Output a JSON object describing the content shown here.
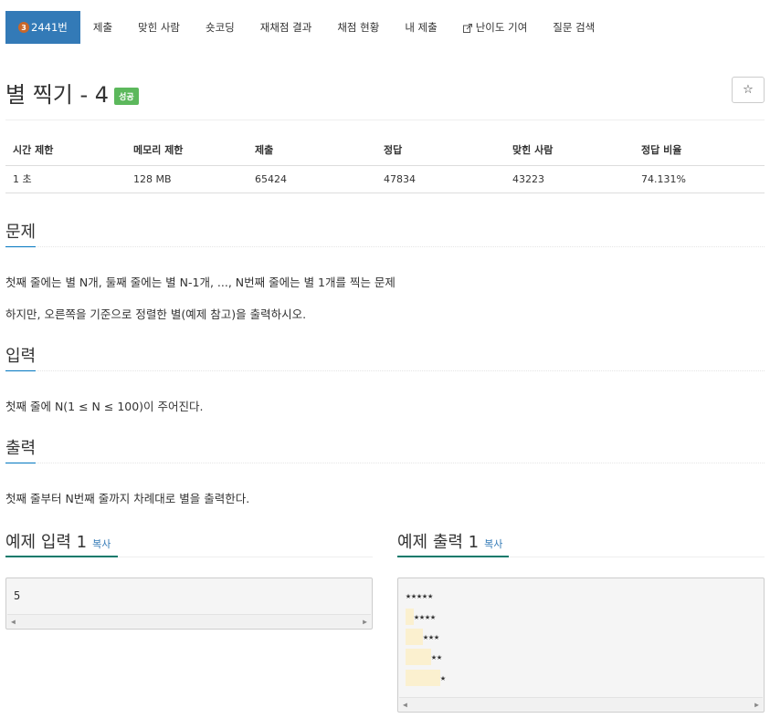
{
  "tabs": [
    {
      "label": "2441번",
      "tier": "3",
      "active": true
    },
    {
      "label": "제출"
    },
    {
      "label": "맞힌 사람"
    },
    {
      "label": "숏코딩"
    },
    {
      "label": "재채점 결과"
    },
    {
      "label": "채점 현황"
    },
    {
      "label": "내 제출"
    },
    {
      "label": "난이도 기여"
    },
    {
      "label": "질문 검색"
    }
  ],
  "problem": {
    "title": "별 찍기 - 4",
    "status_badge": "성공",
    "star_icon": "☆"
  },
  "info_table": {
    "headers": [
      "시간 제한",
      "메모리 제한",
      "제출",
      "정답",
      "맞힌 사람",
      "정답 비율"
    ],
    "values": [
      "1 초",
      "128 MB",
      "65424",
      "47834",
      "43223",
      "74.131%"
    ]
  },
  "sections": {
    "description_heading": "문제",
    "description_lines": [
      "첫째 줄에는 별 N개, 둘째 줄에는 별 N-1개, ..., N번째 줄에는 별 1개를 찍는 문제",
      "하지만, 오른쪽을 기준으로 정렬한 별(예제 참고)을 출력하시오."
    ],
    "input_heading": "입력",
    "input_text": "첫째 줄에 N(1 ≤ N ≤ 100)이 주어진다.",
    "output_heading": "출력",
    "output_text": "첫째 줄부터 N번째 줄까지 차례대로 별을 출력한다."
  },
  "samples": {
    "input_heading": "예제 입력 1",
    "output_heading": "예제 출력 1",
    "copy_label": "복사",
    "input_value": "5",
    "output_lines": [
      "★★★★★",
      " ★★★★",
      "  ★★★",
      "   ★★",
      "    ★"
    ],
    "output_rows": [
      {
        "stars": "★★★★★"
      },
      {
        "stars": "★★★★"
      },
      {
        "stars": "★★★"
      },
      {
        "stars": "★★"
      },
      {
        "stars": "★"
      }
    ]
  },
  "colors": {
    "active_tab": "#337ab7",
    "success_badge": "#5cb85c",
    "link": "#337ab7",
    "highlight_space": "#fbf0cf"
  }
}
